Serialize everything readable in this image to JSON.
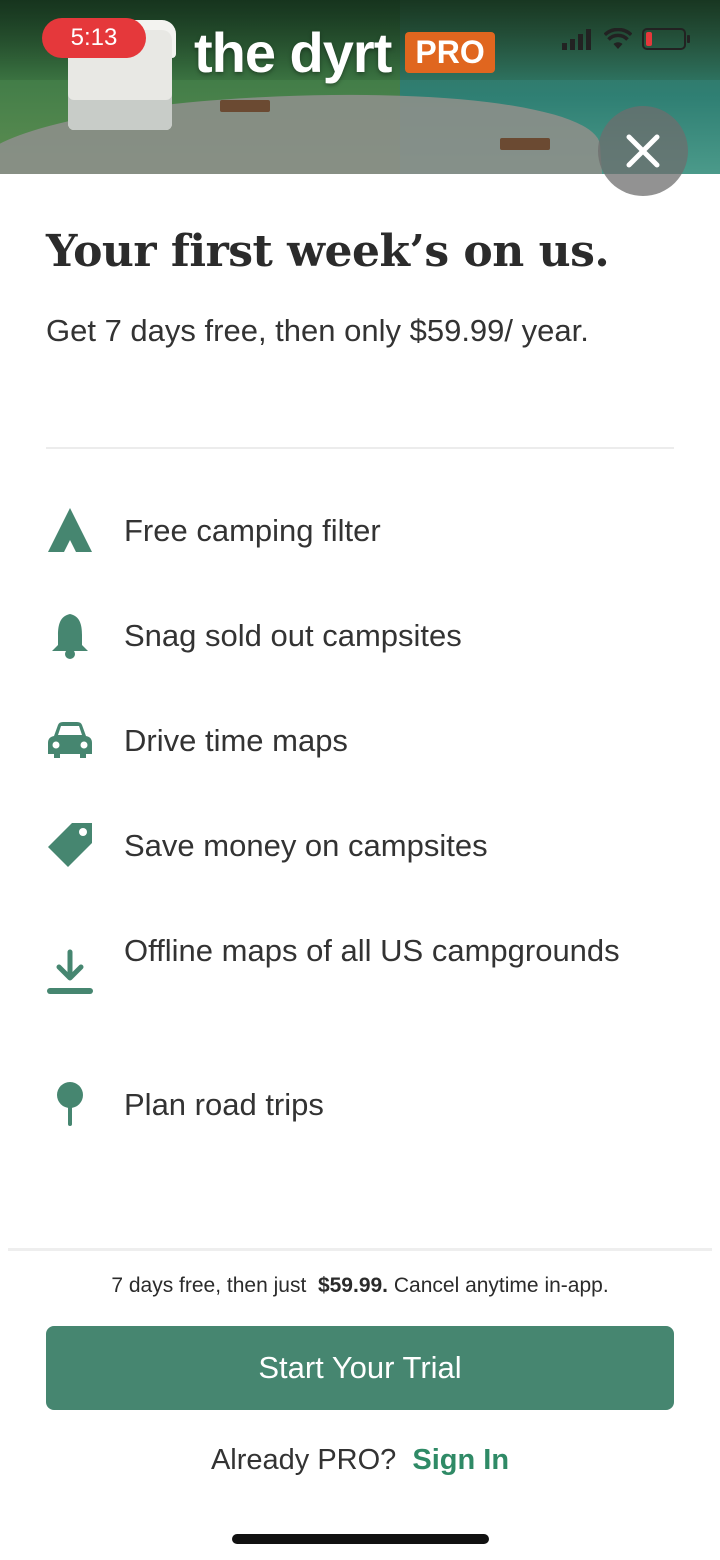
{
  "status_bar": {
    "time": "5:13"
  },
  "header": {
    "logo_text": "the dyrt",
    "badge": "PRO"
  },
  "promo": {
    "headline": "Your first week’s on us.",
    "subhead": "Get 7 days free, then only $59.99/ year."
  },
  "features": [
    {
      "icon": "tent-icon",
      "label": "Free camping filter"
    },
    {
      "icon": "bell-icon",
      "label": "Snag sold out campsites"
    },
    {
      "icon": "car-icon",
      "label": "Drive time maps"
    },
    {
      "icon": "tag-icon",
      "label": "Save money on campsites"
    },
    {
      "icon": "download-icon",
      "label": "Offline maps of all US campgrounds"
    },
    {
      "icon": "pin-icon",
      "label": "Plan road trips"
    }
  ],
  "footer": {
    "fine_pre": "7 days free, then just",
    "fine_price": "$59.99.",
    "fine_post": "Cancel anytime in-app.",
    "cta_label": "Start Your Trial",
    "signin_prompt": "Already PRO?",
    "signin_link": "Sign In"
  },
  "colors": {
    "accent": "#468670",
    "brand_orange": "#e0661f",
    "link": "#2f8a66"
  }
}
